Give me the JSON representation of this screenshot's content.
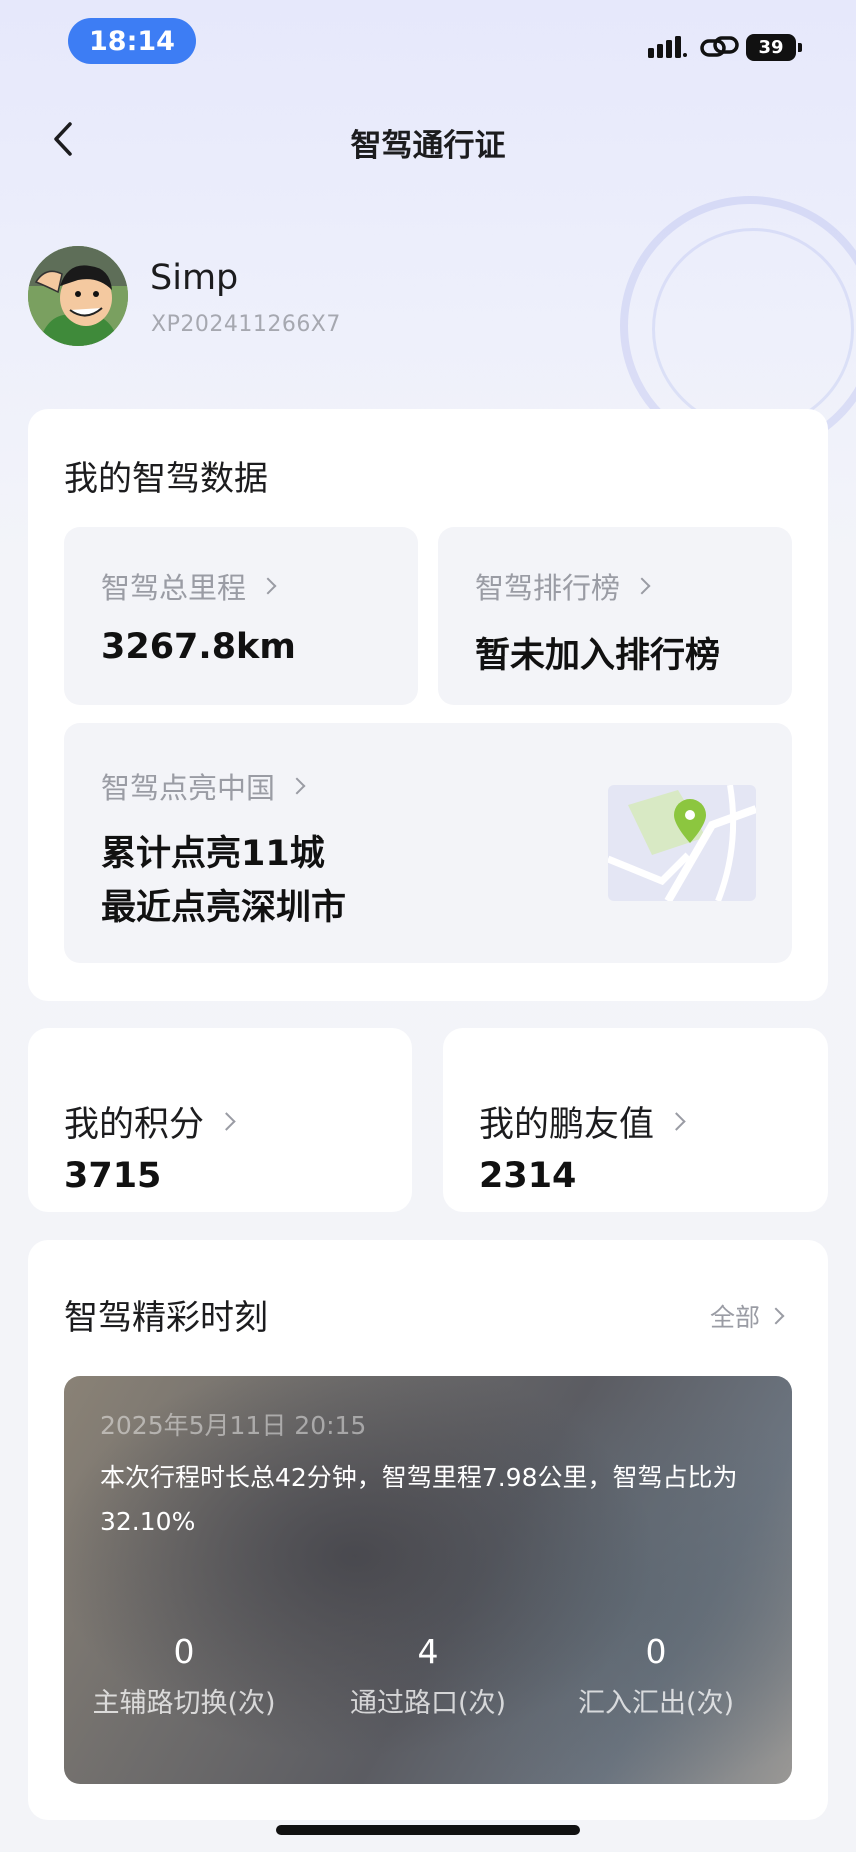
{
  "status": {
    "time": "18:14",
    "battery": "39"
  },
  "nav": {
    "title": "智驾通行证"
  },
  "profile": {
    "name": "Simp",
    "id": "XP202411266X7"
  },
  "smart_data": {
    "title": "我的智驾数据",
    "total_mileage": {
      "label": "智驾总里程",
      "value": "3267.8km"
    },
    "ranking": {
      "label": "智驾排行榜",
      "value": "暂未加入排行榜"
    },
    "light_china": {
      "label": "智驾点亮中国",
      "line1": "累计点亮11城",
      "line2": "最近点亮深圳市"
    }
  },
  "points": {
    "label": "我的积分",
    "value": "3715"
  },
  "friend_value": {
    "label": "我的鹏友值",
    "value": "2314"
  },
  "moments": {
    "title": "智驾精彩时刻",
    "all_label": "全部",
    "date": "2025年5月11日  20:15",
    "summary": "本次行程时长总42分钟，智驾里程7.98公里，智驾占比为32.10%",
    "stats": [
      {
        "value": "0",
        "label": "主辅路切换(次)"
      },
      {
        "value": "4",
        "label": "通过路口(次)"
      },
      {
        "value": "0",
        "label": "汇入汇出(次)"
      }
    ]
  },
  "colors": {
    "accent_blue": "#3d7df4",
    "map_pin": "#8cc63f"
  }
}
